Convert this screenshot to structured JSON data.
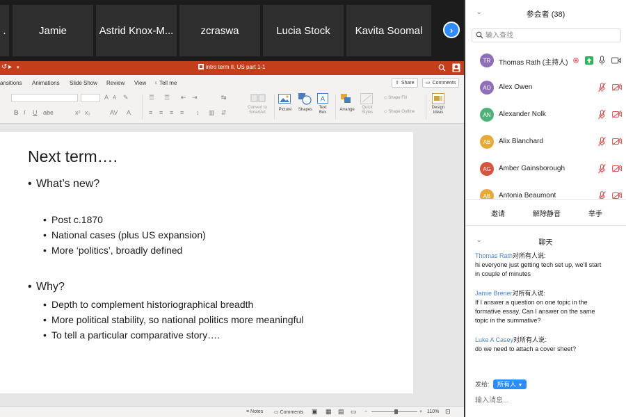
{
  "video_strip": {
    "tiles": [
      ".",
      "Jamie",
      "Astrid Knox-M...",
      "zcraswa",
      "Lucia Stock",
      "Kavita Soomal"
    ],
    "next_glyph": "›",
    "accent": "#2d8cff"
  },
  "powerpoint": {
    "doc_title": "intro term II, US part 1-1",
    "ribbon_tabs": [
      "ansitions",
      "Animations",
      "Slide Show",
      "Review",
      "View",
      "Tell me"
    ],
    "share_label": "Share",
    "comments_label": "Comments",
    "toolbar_labels": {
      "convert": [
        "Convert to",
        "SmartArt"
      ],
      "picture": "Picture",
      "shapes": "Shapes",
      "text_box": [
        "Text",
        "Box"
      ],
      "arrange": "Arrange",
      "quick_styles": [
        "Quick",
        "Styles"
      ],
      "shape_fill": "Shape Fill",
      "shape_outline": "Shape Outline",
      "design_ideas": [
        "Design",
        "Ideas"
      ]
    },
    "slide": {
      "title": "Next term….",
      "level1": [
        "What’s new?",
        "Why?"
      ],
      "whats_new": [
        "Post c.1870",
        "National cases (plus US expansion)",
        "More ‘politics’, broadly defined"
      ],
      "why": [
        "Depth to complement historiographical breadth",
        "More political stability, so national politics more meaningful",
        "To tell a particular comparative story…."
      ]
    },
    "status": {
      "notes": "Notes",
      "comments": "Comments",
      "zoom": "110%"
    },
    "brand_color": "#c43e1c"
  },
  "participants_panel": {
    "title": "参会者 (38)",
    "search_placeholder": "输入查找",
    "participants": [
      {
        "initials": "TR",
        "name": "Thomas Rath (主持人)",
        "color": "#8e6fb8"
      },
      {
        "initials": "AO",
        "name": "Alex Owen",
        "color": "#8e6fb8"
      },
      {
        "initials": "AN",
        "name": "Alexander Nolk",
        "color": "#4fb07a"
      },
      {
        "initials": "AB",
        "name": "Alix Blanchard",
        "color": "#e8a93b"
      },
      {
        "initials": "AG",
        "name": "Amber Gainsborough",
        "color": "#d5553f"
      },
      {
        "initials": "AB",
        "name": "Antonia Beaumont",
        "color": "#e8a93b"
      }
    ],
    "actions": [
      "邀请",
      "解除静音",
      "举手"
    ]
  },
  "chat_panel": {
    "title": "聊天",
    "to_everyone": "对所有人说:",
    "messages": [
      {
        "sender": "Thomas Rath",
        "lines": [
          "hi everyone just getting tech set up, we'll start",
          "in couple of minutes"
        ]
      },
      {
        "sender": "Jamie Brener",
        "lines": [
          "If I answer a question on one topic in the",
          "formative essay. Can I answer on the same",
          "topic in the summative?"
        ]
      },
      {
        "sender": "Luke A Casey",
        "lines": [
          "do we need to attach a cover sheet?"
        ]
      }
    ],
    "send_to_label": "发给:",
    "recipient": "所有人",
    "input_placeholder": "输入消息..."
  }
}
